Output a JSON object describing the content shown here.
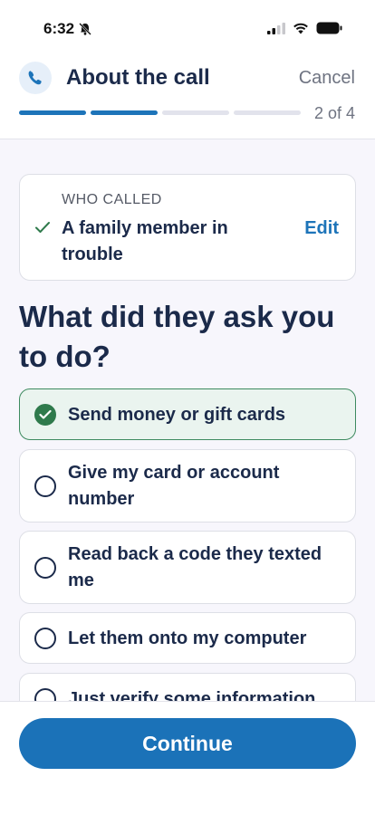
{
  "status_bar": {
    "time": "6:32"
  },
  "header": {
    "title": "About the call",
    "cancel_label": "Cancel",
    "step_text": "2 of 4",
    "progress": {
      "current": 2,
      "total": 4
    }
  },
  "summary": {
    "label": "WHO CALLED",
    "value": "A family member in trouble",
    "edit_label": "Edit"
  },
  "question": "What did they ask you to do?",
  "options": [
    {
      "label": "Send money or gift cards",
      "selected": true
    },
    {
      "label": "Give my card or account number",
      "selected": false
    },
    {
      "label": "Read back a code they texted me",
      "selected": false
    },
    {
      "label": "Let them onto my computer",
      "selected": false
    },
    {
      "label": "Just verify some information",
      "selected": false
    }
  ],
  "footer": {
    "continue_label": "Continue"
  },
  "colors": {
    "accent": "#1d74b9",
    "selected": "#2f7a4c",
    "text": "#1b2a4a"
  }
}
